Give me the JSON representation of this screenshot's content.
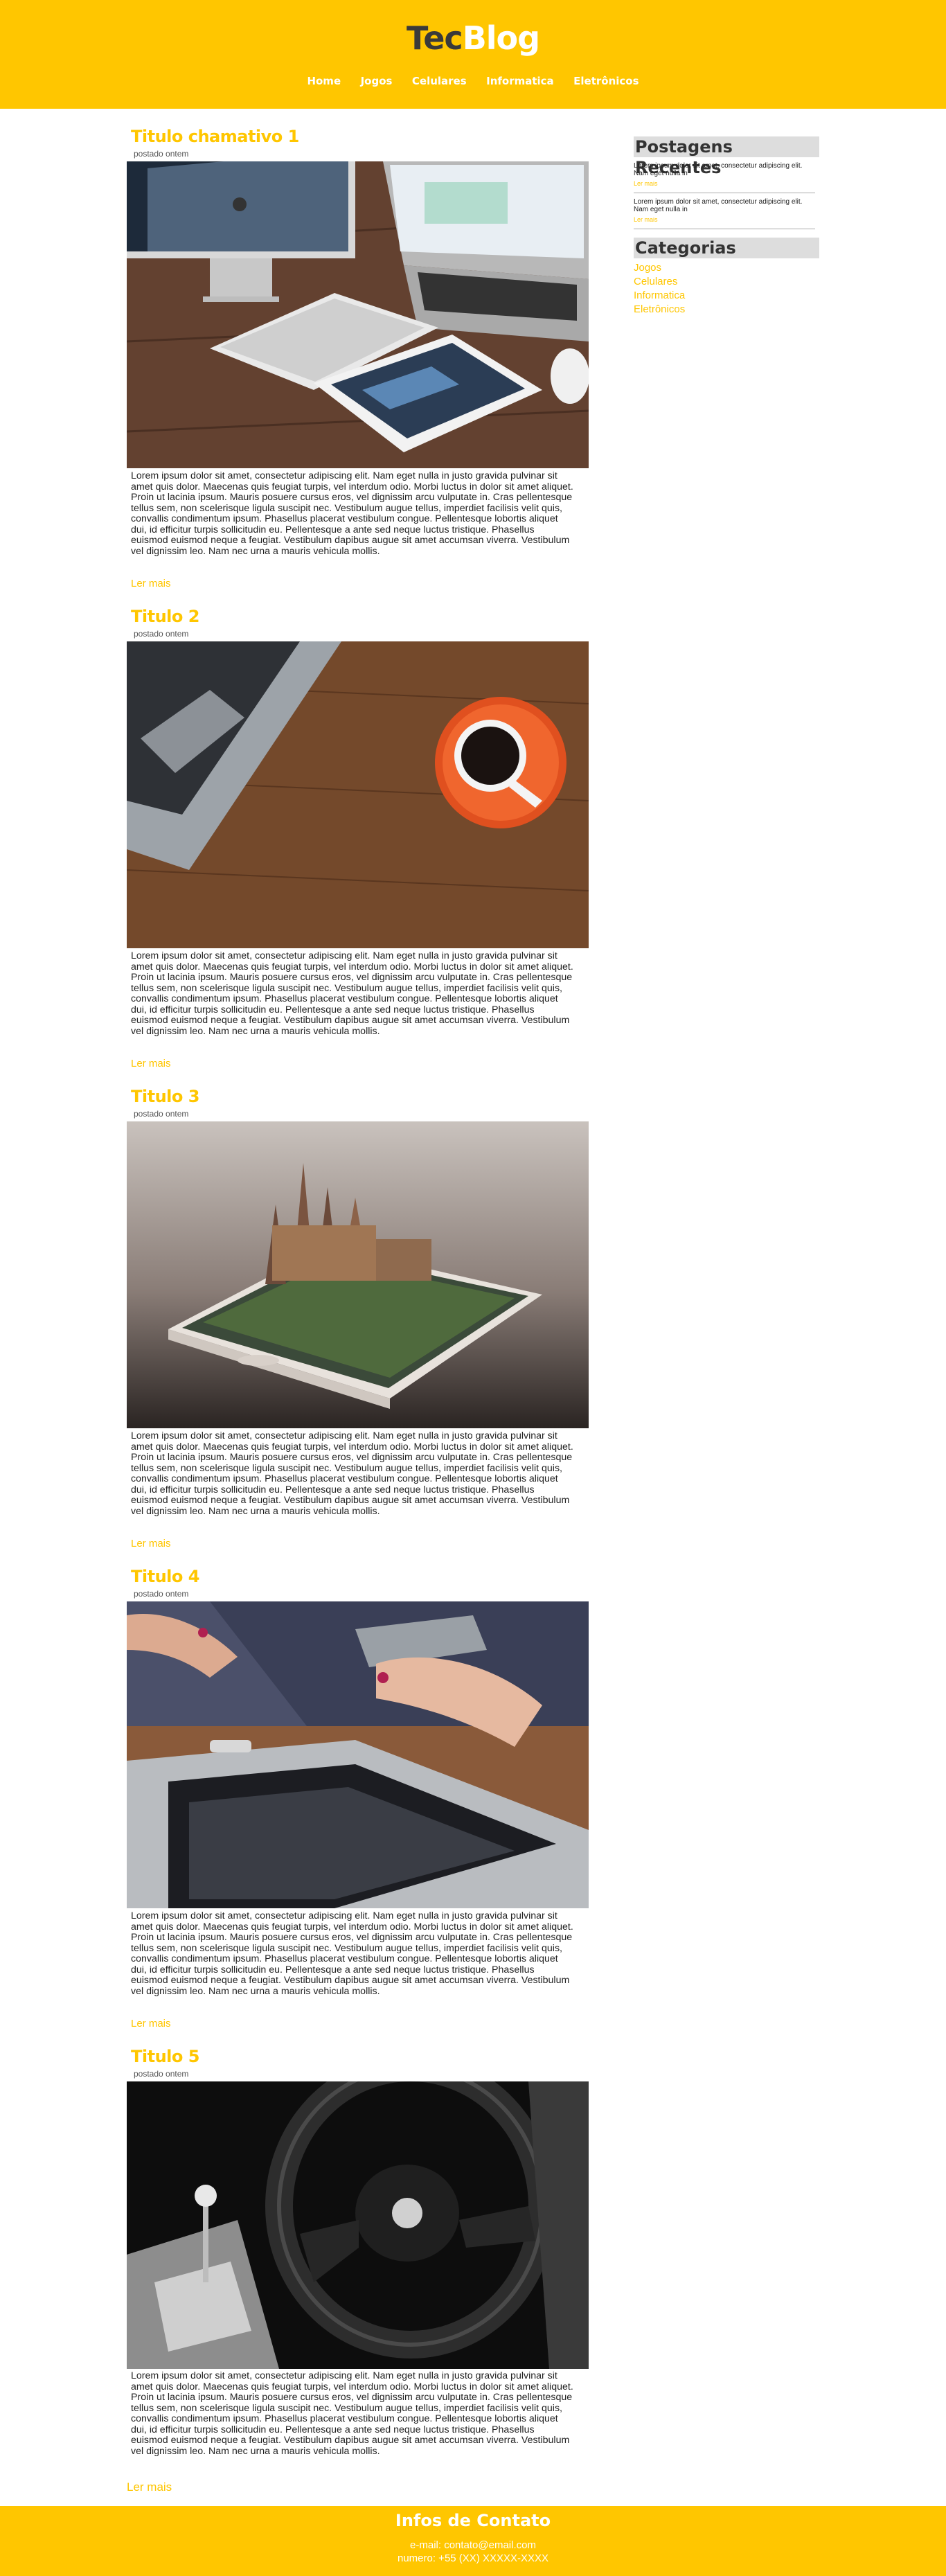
{
  "header": {
    "logo_part1": "Tec",
    "logo_part2": "Blog",
    "nav": [
      "Home",
      "Jogos",
      "Celulares",
      "Informatica",
      "Eletrônicos"
    ]
  },
  "posts": [
    {
      "title": "Titulo chamativo 1",
      "meta": "postado ontem",
      "image": "imac-macbook-ipad-on-desk",
      "more": "Ler mais"
    },
    {
      "title": "Titulo 2",
      "meta": "postado ontem",
      "image": "laptop-and-coffee-cup",
      "more": "Ler mais"
    },
    {
      "title": "Titulo 3",
      "meta": "postado ontem",
      "image": "castle-on-smartphone",
      "more": "Ler mais"
    },
    {
      "title": "Titulo 4",
      "meta": "postado ontem",
      "image": "hands-phone-laptop",
      "more": "Ler mais"
    },
    {
      "title": "Titulo 5",
      "meta": "postado ontem",
      "image": "car-steering-wheel",
      "more": "Ler mais"
    }
  ],
  "post_body": "Lorem ipsum dolor sit amet, consectetur adipiscing elit. Nam eget nulla in justo gravida pulvinar sit amet quis dolor. Maecenas quis feugiat turpis, vel interdum odio. Morbi luctus in dolor sit amet aliquet. Proin ut lacinia ipsum. Mauris posuere cursus eros, vel dignissim arcu vulputate in. Cras pellentesque tellus sem, non scelerisque ligula suscipit nec. Vestibulum augue tellus, imperdiet facilisis velit quis, convallis condimentum ipsum. Phasellus placerat vestibulum congue. Pellentesque lobortis aliquet dui, id efficitur turpis sollicitudin eu. Pellentesque a ante sed neque luctus tristique. Phasellus euismod euismod neque a feugiat. Vestibulum dapibus augue sit amet accumsan viverra. Vestibulum vel dignissim leo. Nam nec urna a mauris vehicula mollis.",
  "sidebar": {
    "recent_title": "Postagens Recentes",
    "recent": [
      {
        "text": "Lorem ipsum dolor sit amet, consectetur adipiscing elit. Nam eget nulla in",
        "more": "Ler mais"
      },
      {
        "text": "Lorem ipsum dolor sit amet, consectetur adipiscing elit. Nam eget nulla in",
        "more": "Ler mais"
      }
    ],
    "categories_title": "Categorias",
    "categories": [
      "Jogos",
      "Celulares",
      "Informatica",
      "Eletrônicos"
    ]
  },
  "footer": {
    "title": "Infos de Contato",
    "email": "e-mail: contato@email.com",
    "phone": "numero: +55 (XX) XXXXX-XXXX"
  },
  "colors": {
    "accent": "#ffc600",
    "dark": "#3a3a3a"
  }
}
